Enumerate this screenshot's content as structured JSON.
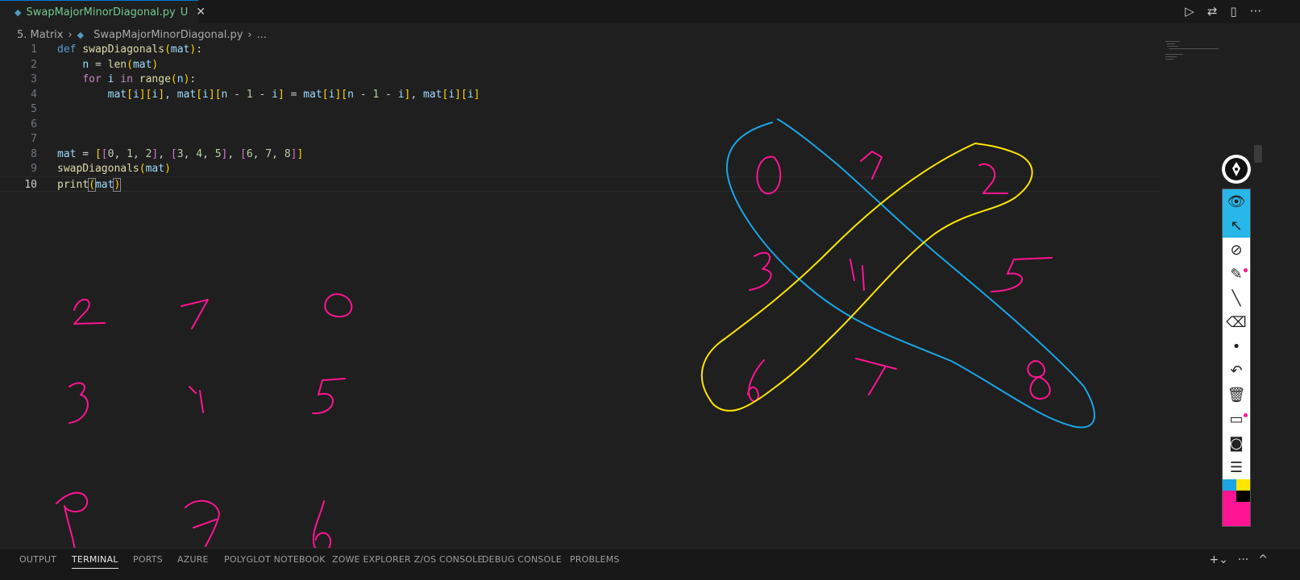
{
  "tab": {
    "filename": "SwapMajorMinorDiagonal.py",
    "status": "U",
    "close": "✕"
  },
  "breadcrumb": {
    "folder": "5. Matrix",
    "file": "SwapMajorMinorDiagonal.py",
    "more": "..."
  },
  "code_lines": [
    {
      "num": "1"
    },
    {
      "num": "2"
    },
    {
      "num": "3"
    },
    {
      "num": "4"
    },
    {
      "num": "5"
    },
    {
      "num": "6"
    },
    {
      "num": "7"
    },
    {
      "num": "8"
    },
    {
      "num": "9"
    },
    {
      "num": "10"
    }
  ],
  "panel_tabs": [
    "OUTPUT",
    "TERMINAL",
    "PORTS",
    "AZURE",
    "POLYGLOT NOTEBOOK",
    "ZOWE EXPLORER Z/OS CONSOLE",
    "DEBUG CONSOLE",
    "PROBLEMS"
  ],
  "panel_active": "TERMINAL",
  "colors": {
    "pen_pink": "#ff1493",
    "pen_cyan": "#1aa6e6",
    "pen_yellow": "#ffe600",
    "accent": "#0078d4"
  },
  "toolbar_icons": [
    "pen-icon",
    "eye-icon",
    "cursor-icon",
    "pen-off-icon",
    "highlighter-icon",
    "line-icon",
    "eraser-icon",
    "dot-icon",
    "undo-icon",
    "trash-icon",
    "whiteboard-icon",
    "camera-icon",
    "clipboard-icon"
  ]
}
